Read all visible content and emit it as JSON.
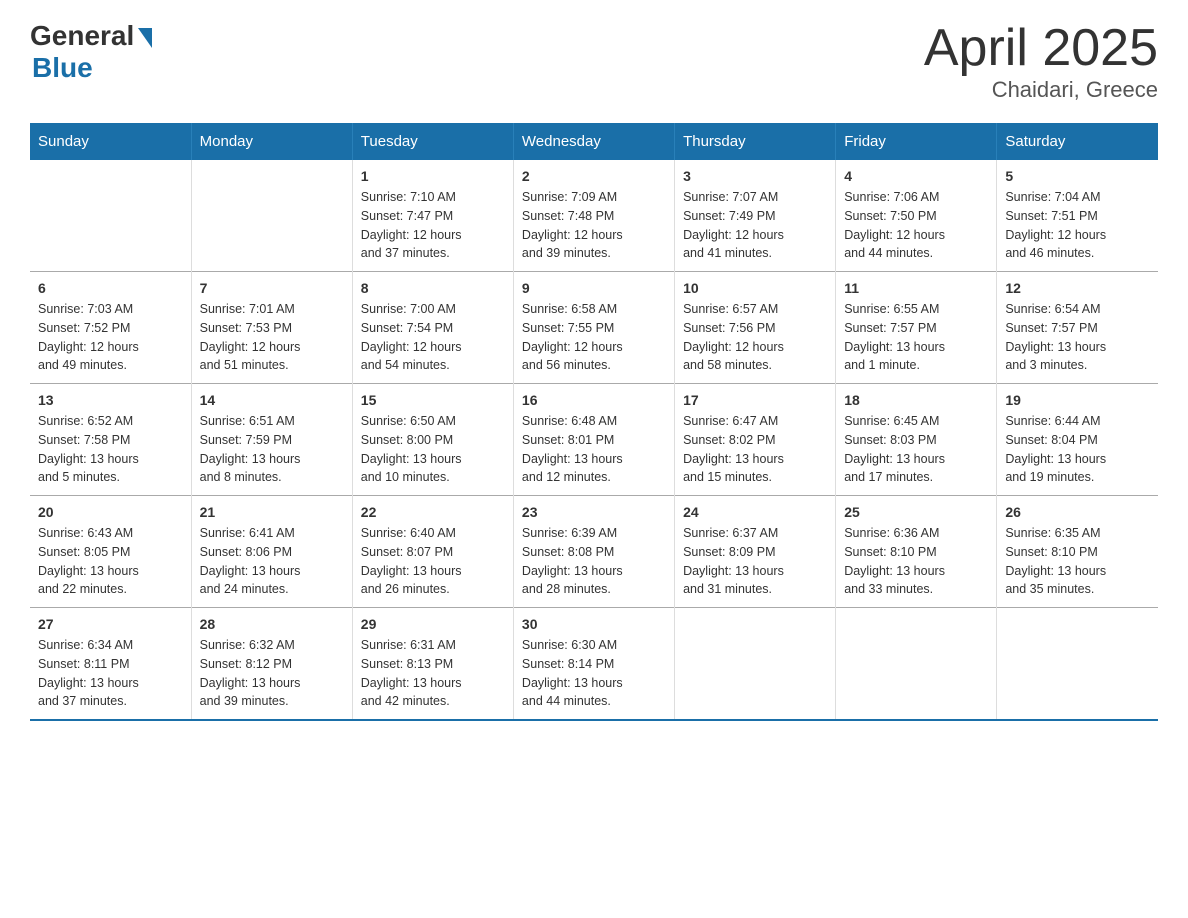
{
  "header": {
    "logo_general": "General",
    "logo_blue": "Blue",
    "title": "April 2025",
    "subtitle": "Chaidari, Greece"
  },
  "days_of_week": [
    "Sunday",
    "Monday",
    "Tuesday",
    "Wednesday",
    "Thursday",
    "Friday",
    "Saturday"
  ],
  "weeks": [
    [
      {
        "day": "",
        "info": ""
      },
      {
        "day": "",
        "info": ""
      },
      {
        "day": "1",
        "info": "Sunrise: 7:10 AM\nSunset: 7:47 PM\nDaylight: 12 hours\nand 37 minutes."
      },
      {
        "day": "2",
        "info": "Sunrise: 7:09 AM\nSunset: 7:48 PM\nDaylight: 12 hours\nand 39 minutes."
      },
      {
        "day": "3",
        "info": "Sunrise: 7:07 AM\nSunset: 7:49 PM\nDaylight: 12 hours\nand 41 minutes."
      },
      {
        "day": "4",
        "info": "Sunrise: 7:06 AM\nSunset: 7:50 PM\nDaylight: 12 hours\nand 44 minutes."
      },
      {
        "day": "5",
        "info": "Sunrise: 7:04 AM\nSunset: 7:51 PM\nDaylight: 12 hours\nand 46 minutes."
      }
    ],
    [
      {
        "day": "6",
        "info": "Sunrise: 7:03 AM\nSunset: 7:52 PM\nDaylight: 12 hours\nand 49 minutes."
      },
      {
        "day": "7",
        "info": "Sunrise: 7:01 AM\nSunset: 7:53 PM\nDaylight: 12 hours\nand 51 minutes."
      },
      {
        "day": "8",
        "info": "Sunrise: 7:00 AM\nSunset: 7:54 PM\nDaylight: 12 hours\nand 54 minutes."
      },
      {
        "day": "9",
        "info": "Sunrise: 6:58 AM\nSunset: 7:55 PM\nDaylight: 12 hours\nand 56 minutes."
      },
      {
        "day": "10",
        "info": "Sunrise: 6:57 AM\nSunset: 7:56 PM\nDaylight: 12 hours\nand 58 minutes."
      },
      {
        "day": "11",
        "info": "Sunrise: 6:55 AM\nSunset: 7:57 PM\nDaylight: 13 hours\nand 1 minute."
      },
      {
        "day": "12",
        "info": "Sunrise: 6:54 AM\nSunset: 7:57 PM\nDaylight: 13 hours\nand 3 minutes."
      }
    ],
    [
      {
        "day": "13",
        "info": "Sunrise: 6:52 AM\nSunset: 7:58 PM\nDaylight: 13 hours\nand 5 minutes."
      },
      {
        "day": "14",
        "info": "Sunrise: 6:51 AM\nSunset: 7:59 PM\nDaylight: 13 hours\nand 8 minutes."
      },
      {
        "day": "15",
        "info": "Sunrise: 6:50 AM\nSunset: 8:00 PM\nDaylight: 13 hours\nand 10 minutes."
      },
      {
        "day": "16",
        "info": "Sunrise: 6:48 AM\nSunset: 8:01 PM\nDaylight: 13 hours\nand 12 minutes."
      },
      {
        "day": "17",
        "info": "Sunrise: 6:47 AM\nSunset: 8:02 PM\nDaylight: 13 hours\nand 15 minutes."
      },
      {
        "day": "18",
        "info": "Sunrise: 6:45 AM\nSunset: 8:03 PM\nDaylight: 13 hours\nand 17 minutes."
      },
      {
        "day": "19",
        "info": "Sunrise: 6:44 AM\nSunset: 8:04 PM\nDaylight: 13 hours\nand 19 minutes."
      }
    ],
    [
      {
        "day": "20",
        "info": "Sunrise: 6:43 AM\nSunset: 8:05 PM\nDaylight: 13 hours\nand 22 minutes."
      },
      {
        "day": "21",
        "info": "Sunrise: 6:41 AM\nSunset: 8:06 PM\nDaylight: 13 hours\nand 24 minutes."
      },
      {
        "day": "22",
        "info": "Sunrise: 6:40 AM\nSunset: 8:07 PM\nDaylight: 13 hours\nand 26 minutes."
      },
      {
        "day": "23",
        "info": "Sunrise: 6:39 AM\nSunset: 8:08 PM\nDaylight: 13 hours\nand 28 minutes."
      },
      {
        "day": "24",
        "info": "Sunrise: 6:37 AM\nSunset: 8:09 PM\nDaylight: 13 hours\nand 31 minutes."
      },
      {
        "day": "25",
        "info": "Sunrise: 6:36 AM\nSunset: 8:10 PM\nDaylight: 13 hours\nand 33 minutes."
      },
      {
        "day": "26",
        "info": "Sunrise: 6:35 AM\nSunset: 8:10 PM\nDaylight: 13 hours\nand 35 minutes."
      }
    ],
    [
      {
        "day": "27",
        "info": "Sunrise: 6:34 AM\nSunset: 8:11 PM\nDaylight: 13 hours\nand 37 minutes."
      },
      {
        "day": "28",
        "info": "Sunrise: 6:32 AM\nSunset: 8:12 PM\nDaylight: 13 hours\nand 39 minutes."
      },
      {
        "day": "29",
        "info": "Sunrise: 6:31 AM\nSunset: 8:13 PM\nDaylight: 13 hours\nand 42 minutes."
      },
      {
        "day": "30",
        "info": "Sunrise: 6:30 AM\nSunset: 8:14 PM\nDaylight: 13 hours\nand 44 minutes."
      },
      {
        "day": "",
        "info": ""
      },
      {
        "day": "",
        "info": ""
      },
      {
        "day": "",
        "info": ""
      }
    ]
  ]
}
